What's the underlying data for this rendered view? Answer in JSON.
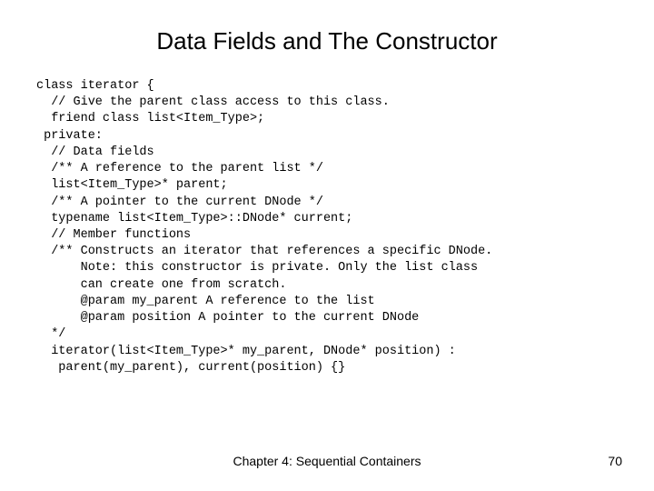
{
  "title": "Data Fields and The Constructor",
  "code": "class iterator {\n  // Give the parent class access to this class.\n  friend class list<Item_Type>;\n private:\n  // Data fields\n  /** A reference to the parent list */\n  list<Item_Type>* parent;\n  /** A pointer to the current DNode */\n  typename list<Item_Type>::DNode* current;\n  // Member functions\n  /** Constructs an iterator that references a specific DNode.\n      Note: this constructor is private. Only the list class\n      can create one from scratch.\n      @param my_parent A reference to the list\n      @param position A pointer to the current DNode\n  */\n  iterator(list<Item_Type>* my_parent, DNode* position) :\n   parent(my_parent), current(position) {}",
  "footer": "Chapter 4: Sequential Containers",
  "page_number": "70"
}
